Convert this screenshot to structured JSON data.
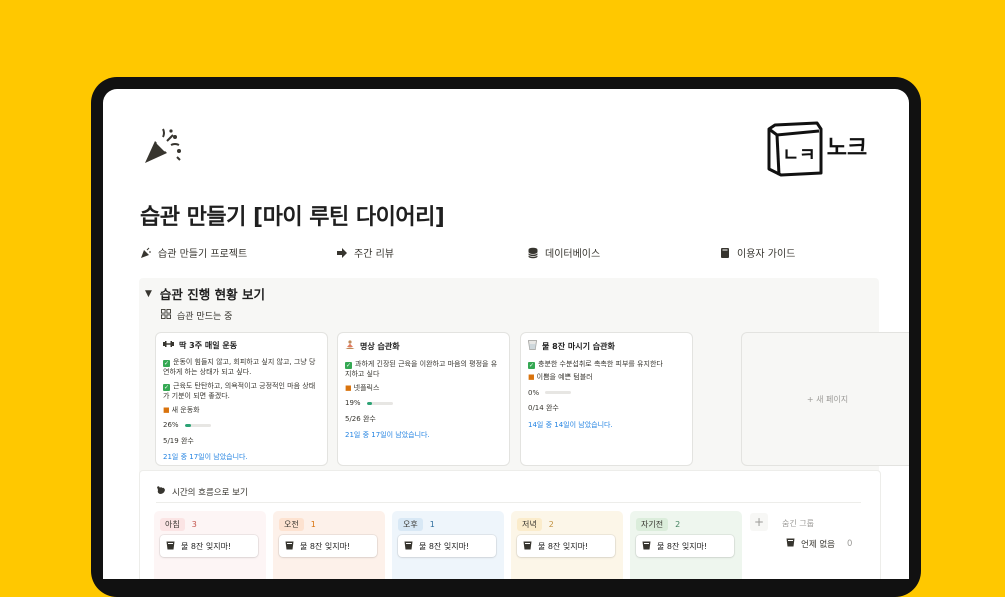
{
  "page": {
    "icon": "party-popper-icon",
    "title": "습관 만들기 [마이 루틴 다이어리]"
  },
  "brand": {
    "logo_text": "노크",
    "logo_box_text": "ㄴㅋ",
    "icon": "knock-logo-icon"
  },
  "links": [
    {
      "icon": "party-popper-icon",
      "label": "습관 만들기 프로젝트"
    },
    {
      "icon": "arrow-right-icon",
      "label": "주간 리뷰"
    },
    {
      "icon": "database-icon",
      "label": "데이터베이스"
    },
    {
      "icon": "book-icon",
      "label": "이용자 가이드"
    }
  ],
  "section": {
    "title": "습관 진행 현황 보기",
    "view_tab": "습관 만드는 중",
    "view_icon": "gallery-icon",
    "new_page": "+ 새 페이지"
  },
  "cards": [
    {
      "icon": "dumbbell-icon",
      "title": "딱 3주 매일 운동",
      "desc": [
        "운동이 힘들지 않고, 회피하고 싶지 않고, 그냥 당연하게 하는 상태가 되고 싶다.",
        "근육도 탄탄하고, 의욕적이고 긍정적인 마음 상태가 기분이 되면 좋겠다."
      ],
      "reward": "새 운동화",
      "percent": "26%",
      "progress": 0.26,
      "done": "5/19 완수",
      "remain": "21일 중 17일이 남았습니다."
    },
    {
      "icon": "meditation-icon",
      "title": "명상 습관화",
      "desc": [
        "과하게 긴장된 근육을 이완하고 마음의 평정을 유지하고 싶다"
      ],
      "reward": "넷플릭스",
      "percent": "19%",
      "progress": 0.19,
      "done": "5/26 완수",
      "remain": "21일 중 17일이 남았습니다."
    },
    {
      "icon": "water-glass-icon",
      "title": "물 8잔 마시기 습관화",
      "desc": [
        "충분한 수분섭취로 촉촉한 피부를 유지한다"
      ],
      "reward": "이쁨을 예쁜 텀블러",
      "percent": "0%",
      "progress": 0,
      "done": "0/14 완수",
      "remain": "14일 중 14일이 남았습니다."
    }
  ],
  "board": {
    "title": "시간의 흐름으로 보기",
    "icon": "rooster-icon",
    "columns": [
      {
        "label": "아침",
        "count": "3",
        "tag_bg": "#fbe4e4",
        "col_bg": "#fdf5f5",
        "count_color": "#c4554d",
        "item": "물 8잔 잊지마!"
      },
      {
        "label": "오전",
        "count": "1",
        "tag_bg": "#fde2d0",
        "col_bg": "#fdf1ea",
        "count_color": "#d9730d",
        "item": "물 8잔 잊지마!"
      },
      {
        "label": "오후",
        "count": "1",
        "tag_bg": "#d8e8f5",
        "col_bg": "#eef5fb",
        "count_color": "#2f6e9e",
        "item": "물 8잔 잊지마!"
      },
      {
        "label": "저녁",
        "count": "2",
        "tag_bg": "#fbeccb",
        "col_bg": "#fcf6e8",
        "count_color": "#c29343",
        "item": "물 8잔 잊지마!"
      },
      {
        "label": "자기전",
        "count": "2",
        "tag_bg": "#dbeddb",
        "col_bg": "#eef6ee",
        "count_color": "#448361",
        "item": "물 8잔 잊지마!"
      }
    ],
    "hidden_groups": "숨긴 그룹",
    "no_date": "언제 없음",
    "no_date_count": "0"
  }
}
